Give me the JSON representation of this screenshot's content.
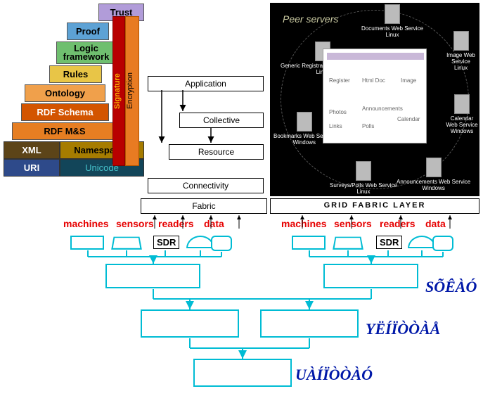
{
  "semantic_stack": {
    "trust": "Trust",
    "proof": "Proof",
    "logic": "Logic framework",
    "rules": "Rules",
    "ontology": "Ontology",
    "rdfschema": "RDF Schema",
    "rdfms": "RDF M&S",
    "xml": "XML",
    "namespaces": "Namespaces",
    "uri": "URI",
    "unicode": "Unicode",
    "signature": "Signature",
    "encryption": "Encryption"
  },
  "middle_layers": {
    "application": "Application",
    "collective": "Collective",
    "resource": "Resource",
    "connectivity": "Connectivity",
    "fabric": "Fabric"
  },
  "right_panel": {
    "title": "Peer servers",
    "grid_fabric": "GRID FABRIC LAYER",
    "nodes": {
      "documents": "Documents Web Service",
      "image": "Image Web Service",
      "calendar": "Calendar Web Service",
      "announcements": "Announcements Web Service",
      "surveys": "Surveys/Polls Web Service",
      "bookmarks": "Bookmarks Web Service",
      "registration": "Generic Registration Web Service"
    },
    "os": {
      "linux": "Linux",
      "windows": "Windows"
    },
    "center": {
      "register": "Register",
      "htmldoc": "Html Doc",
      "image": "Image",
      "photos": "Photos",
      "announcements": "Announcements",
      "links": "Links",
      "polls": "Polls",
      "calendar": "Calendar"
    }
  },
  "red_labels": {
    "left": [
      "machines",
      "sensors",
      "readers",
      "data"
    ],
    "right": [
      "machines",
      "sensors",
      "readers",
      "data"
    ]
  },
  "tree": {
    "sdr": "SDR",
    "blue1": "SÕÊÀÓ",
    "blue2": "YËÍÏÒÒÀÅ",
    "blue3": "UÀÍÏÒÒÀÓ"
  }
}
